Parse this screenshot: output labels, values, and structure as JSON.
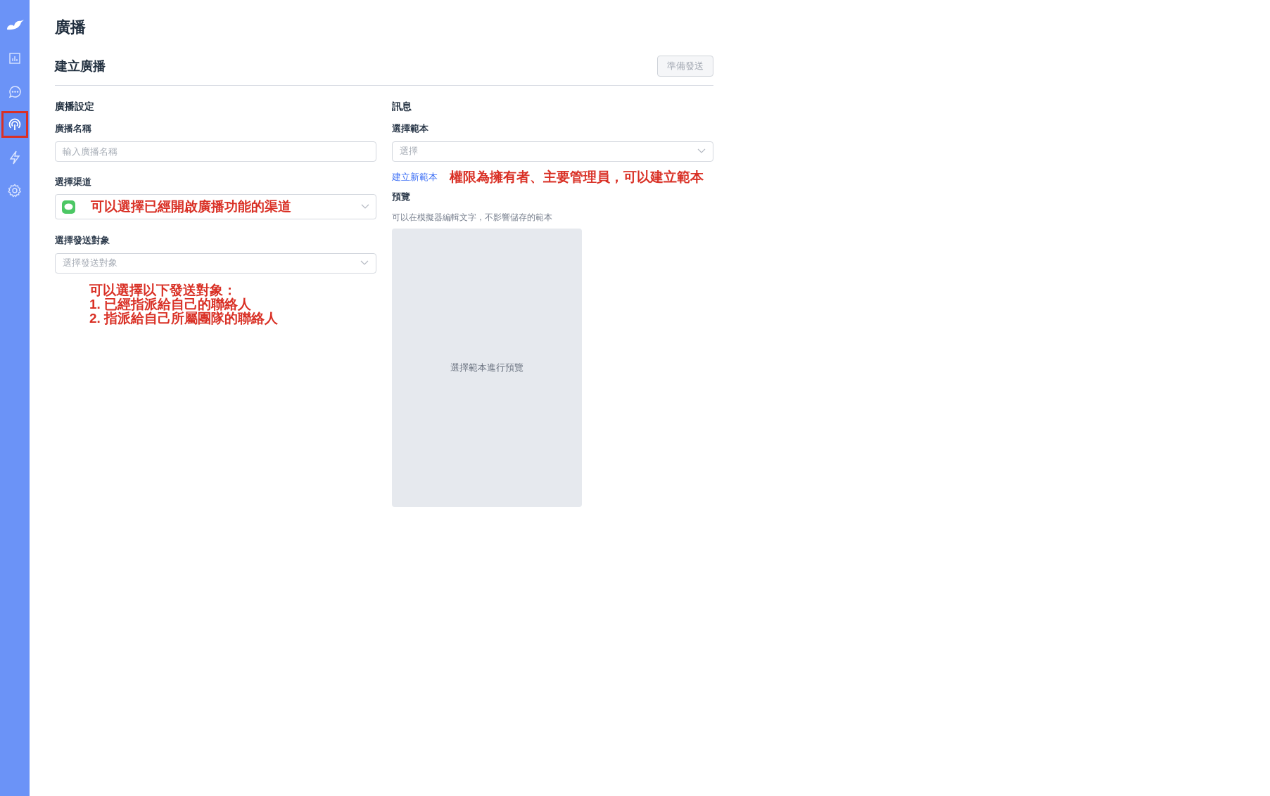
{
  "sidebar": {
    "items": [
      {
        "kind": "chart",
        "selected": false,
        "highlighted": false
      },
      {
        "kind": "chat",
        "selected": false,
        "highlighted": false
      },
      {
        "kind": "broadcast",
        "selected": true,
        "highlighted": true
      },
      {
        "kind": "bolt",
        "selected": false,
        "highlighted": false
      },
      {
        "kind": "settings",
        "selected": false,
        "highlighted": false
      }
    ]
  },
  "page_title": "廣播",
  "section_title": "建立廣播",
  "send_button": {
    "label": "準備發送",
    "disabled": true
  },
  "settings": {
    "heading": "廣播設定",
    "name_field": {
      "label": "廣播名稱",
      "placeholder": "輸入廣播名稱"
    },
    "channel_field": {
      "label": "選擇渠道",
      "annotation": "可以選擇已經開啟廣播功能的渠道"
    },
    "audience_field": {
      "label": "選擇發送對象",
      "placeholder": "選擇發送對象"
    },
    "audience_annotation": [
      "可以選擇以下發送對象：",
      "1. 已經指派給自己的聯絡人",
      "2. 指派給自己所屬團隊的聯絡人"
    ]
  },
  "message": {
    "heading": "訊息",
    "template_field": {
      "label": "選擇範本",
      "placeholder": "選擇"
    },
    "new_template_link": "建立新範本",
    "template_annotation": "權限為擁有者、主要管理員，可以建立範本",
    "preview_label": "預覽",
    "preview_hint": "可以在模擬器編輯文字，不影響儲存的範本",
    "preview_empty": "選擇範本進行預覽"
  }
}
